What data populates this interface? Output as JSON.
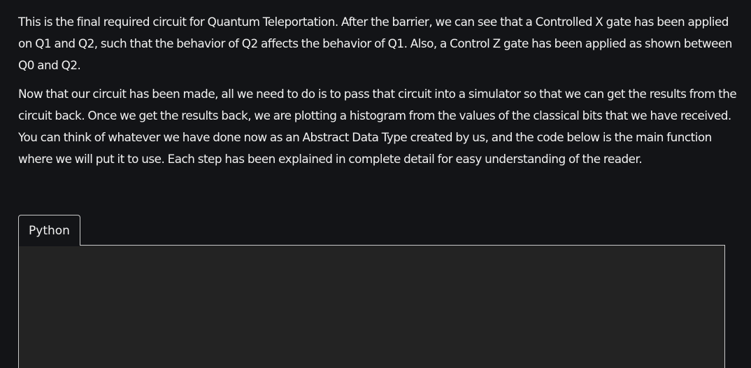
{
  "article": {
    "paragraphs": [
      "This is the final required circuit for Quantum Teleportation. After the barrier, we can see that a Controlled X gate has been applied on Q1 and Q2, such that the behavior of Q2 affects the behavior of Q1. Also, a Control Z gate has been applied as shown between Q0 and Q2.",
      "Now that our circuit has been made, all we need to do is to pass that circuit into a simulator so that we can get the results from the circuit back. Once we get the results back, we are plotting a histogram from the values of the classical bits that we have received. You can think of whatever we have done now as an Abstract Data Type created by us, and the code below is the main function where we will put it to use. Each step has been explained in complete detail for easy understanding of the reader."
    ]
  },
  "code_block": {
    "tab_label": "Python",
    "code": ""
  }
}
